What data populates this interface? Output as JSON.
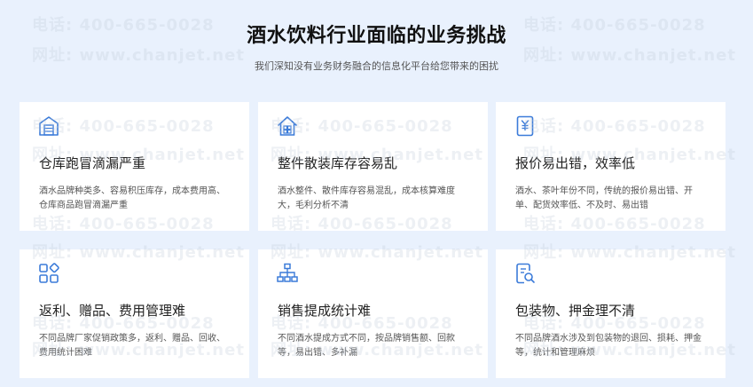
{
  "header": {
    "title": "酒水饮料行业面临的业务挑战",
    "subtitle": "我们深知没有业务财务融合的信息化平台给您带来的困扰"
  },
  "watermark": {
    "phone": "电话: 400-665-0028",
    "site": "网址: www.chanjet.net"
  },
  "colors": {
    "icon": "#3b7bd9",
    "background": "#e9f1fd"
  },
  "cards": [
    {
      "icon": "warehouse-icon",
      "title": "仓库跑冒滴漏严重",
      "desc": "酒水品牌种类多、容易积压库存，成本费用高、仓库商品跑冒滴漏严重"
    },
    {
      "icon": "home-boxes-icon",
      "title": "整件散装库存容易乱",
      "desc": "酒水整件、散件库存容易混乱，成本核算难度大，毛利分析不清"
    },
    {
      "icon": "price-doc-icon",
      "title": "报价易出错，效率低",
      "desc": "酒水、茶叶年份不同，传统的报价易出错、开单、配货效率低、不及时、易出错"
    },
    {
      "icon": "apps-grid-icon",
      "title": "返利、赠品、费用管理难",
      "desc": "不同品牌厂家促销政策多，返利、赠品、回收、费用统计困难"
    },
    {
      "icon": "org-tree-icon",
      "title": "销售提成统计难",
      "desc": "不同酒水提成方式不同，按品牌销售额、回款等，易出错、多补漏"
    },
    {
      "icon": "doc-search-icon",
      "title": "包装物、押金理不清",
      "desc": "不同品牌酒水涉及到包装物的退回、损耗、押金等，统计和管理麻烦"
    }
  ]
}
